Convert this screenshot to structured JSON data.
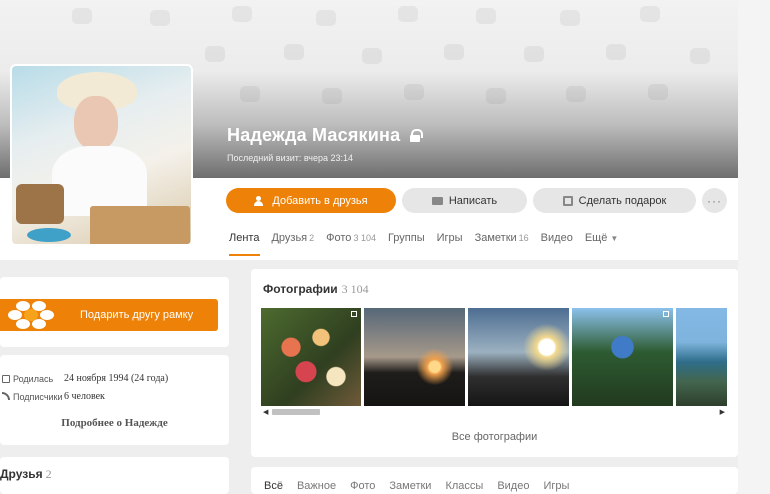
{
  "profile": {
    "name": "Надежда Масякина",
    "last_visit": "Последний визит: вчера 23:14"
  },
  "actions": {
    "add_friend": "Добавить в друзья",
    "write": "Написать",
    "gift": "Сделать подарок",
    "more": "···"
  },
  "tabs": [
    {
      "label": "Лента",
      "count": ""
    },
    {
      "label": "Друзья",
      "count": "2"
    },
    {
      "label": "Фото",
      "count": "3 104"
    },
    {
      "label": "Группы",
      "count": ""
    },
    {
      "label": "Игры",
      "count": ""
    },
    {
      "label": "Заметки",
      "count": "16"
    },
    {
      "label": "Видео",
      "count": ""
    },
    {
      "label": "Ещё",
      "count": ""
    }
  ],
  "sidebar": {
    "frame_button": "Подарить другу рамку",
    "birthday_label": "Родилась",
    "birthday_value": "24 ноября 1994 (24 года)",
    "subscribers_label": "Подписчики",
    "subscribers_value": "6 человек",
    "more_about": "Подробнее о Надежде",
    "friends_title": "Друзья",
    "friends_count": "2"
  },
  "photos": {
    "title": "Фотографии",
    "count": "3 104",
    "all_link": "Все фотографии",
    "scroll_left": "◀",
    "scroll_right": "▶"
  },
  "feed_filters": [
    "Всё",
    "Важное",
    "Фото",
    "Заметки",
    "Классы",
    "Видео",
    "Игры"
  ],
  "colors": {
    "accent": "#ee8208"
  }
}
